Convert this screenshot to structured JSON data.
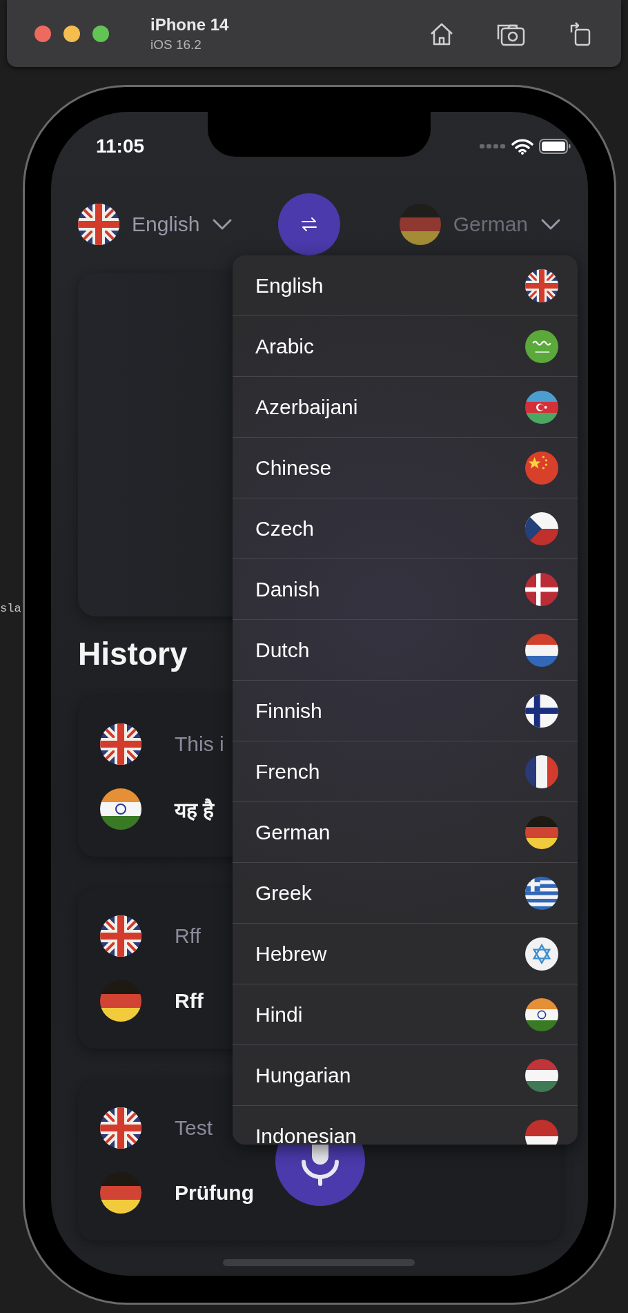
{
  "editor_behind": {
    "code_fragment": "sla"
  },
  "simulator": {
    "device": "iPhone 14",
    "os": "iOS 16.2"
  },
  "status_bar": {
    "time": "11:05"
  },
  "language_bar": {
    "source": {
      "label": "English",
      "flag": {
        "kind": "gb"
      },
      "pressed": false
    },
    "target": {
      "label": "German",
      "flag": {
        "kind": "de"
      },
      "pressed": true
    }
  },
  "history": {
    "title": "History",
    "entries": [
      {
        "source": {
          "flag": {
            "kind": "gb"
          },
          "text": "This i"
        },
        "target": {
          "flag": {
            "kind": "in"
          },
          "text": "यह है"
        }
      },
      {
        "source": {
          "flag": {
            "kind": "gb"
          },
          "text": "Rff"
        },
        "target": {
          "flag": {
            "kind": "de"
          },
          "text": "Rff"
        }
      },
      {
        "source": {
          "flag": {
            "kind": "gb"
          },
          "text": "Test"
        },
        "target": {
          "flag": {
            "kind": "de"
          },
          "text": "Prüfung"
        }
      }
    ]
  },
  "language_menu": {
    "items": [
      {
        "label": "English",
        "flag": {
          "kind": "gb"
        }
      },
      {
        "label": "Arabic",
        "flag": {
          "kind": "sa"
        }
      },
      {
        "label": "Azerbaijani",
        "flag": {
          "kind": "az"
        }
      },
      {
        "label": "Chinese",
        "flag": {
          "kind": "cn"
        }
      },
      {
        "label": "Czech",
        "flag": {
          "kind": "cz"
        }
      },
      {
        "label": "Danish",
        "flag": {
          "kind": "dk"
        }
      },
      {
        "label": "Dutch",
        "flag": {
          "kind": "nl"
        }
      },
      {
        "label": "Finnish",
        "flag": {
          "kind": "fi"
        }
      },
      {
        "label": "French",
        "flag": {
          "kind": "fr"
        }
      },
      {
        "label": "German",
        "flag": {
          "kind": "de"
        }
      },
      {
        "label": "Greek",
        "flag": {
          "kind": "gr"
        }
      },
      {
        "label": "Hebrew",
        "flag": {
          "kind": "il"
        }
      },
      {
        "label": "Hindi",
        "flag": {
          "kind": "in"
        }
      },
      {
        "label": "Hungarian",
        "flag": {
          "kind": "hu"
        }
      },
      {
        "label": "Indonesian",
        "flag": {
          "kind": "id"
        }
      }
    ]
  }
}
